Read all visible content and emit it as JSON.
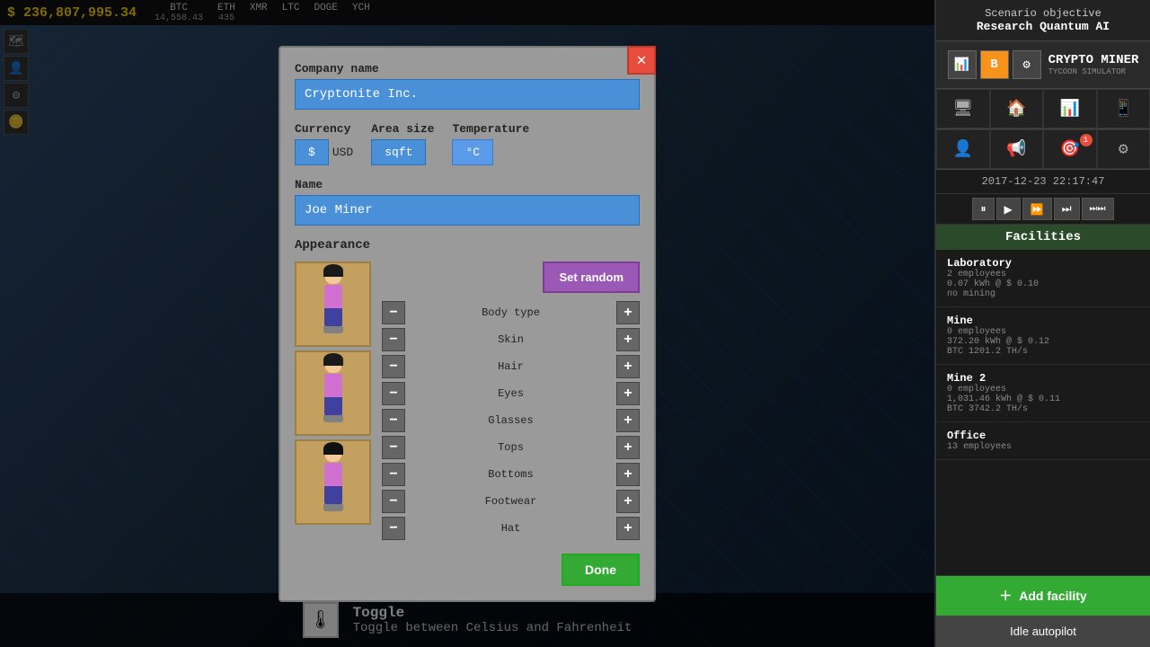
{
  "topbar": {
    "money": "$ 236,807,995.34",
    "cryptos": [
      {
        "symbol": "BTC",
        "value": "14,558.43"
      },
      {
        "symbol": "ETH",
        "value": "435"
      },
      {
        "symbol": "XMR",
        "value": ""
      },
      {
        "symbol": "LTC",
        "value": ""
      },
      {
        "symbol": "DOGE",
        "value": ""
      },
      {
        "symbol": "YCH",
        "value": ""
      }
    ]
  },
  "sidebar": {
    "scenario_label": "Scenario objective",
    "scenario_name": "Research Quantum AI",
    "logo_title": "CRYPTO MINER",
    "logo_sub": "TYCOON SIMULATOR",
    "datetime": "2017-12-23 22:17:47",
    "facilities_header": "Facilities",
    "facilities": [
      {
        "name": "Laboratory",
        "employees": "2 employees",
        "detail1": "0.07 kWh @ $ 0.10",
        "detail2": "no mining"
      },
      {
        "name": "Mine",
        "employees": "0 employees",
        "detail1": "372.20 kWh @ $ 0.12",
        "detail2": "BTC 1201.2 TH/s"
      },
      {
        "name": "Mine 2",
        "employees": "0 employees",
        "detail1": "1,031.46 kWh @ $ 0.11",
        "detail2": "BTC 3742.2 TH/s"
      },
      {
        "name": "Office",
        "employees": "13 employees",
        "detail1": "",
        "detail2": ""
      }
    ],
    "add_facility_btn": "Add facility",
    "idle_btn": "Idle autopilot",
    "notification_count": "1"
  },
  "modal": {
    "company_name_label": "Company name",
    "company_name_value": "Cryptonite Inc.",
    "currency_label": "Currency",
    "currency_symbol": "$",
    "currency_name": "USD",
    "area_label": "Area size",
    "area_value": "sqft",
    "temp_label": "Temperature",
    "temp_value": "°C",
    "name_label": "Name",
    "name_value": "Joe Miner",
    "appearance_label": "Appearance",
    "set_random_btn": "Set random",
    "done_btn": "Done",
    "appearance_rows": [
      {
        "label": "Body type"
      },
      {
        "label": "Skin"
      },
      {
        "label": "Hair"
      },
      {
        "label": "Eyes"
      },
      {
        "label": "Glasses"
      },
      {
        "label": "Tops"
      },
      {
        "label": "Bottoms"
      },
      {
        "label": "Footwear"
      },
      {
        "label": "Hat"
      }
    ]
  },
  "bottom": {
    "toggle_label": "Toggle",
    "toggle_desc": "Toggle between Celsius and Fahrenheit"
  },
  "icons": {
    "monitor": "🖥",
    "home": "🏠",
    "chart": "📊",
    "phone": "📱",
    "person": "👤",
    "megaphone": "📢",
    "target": "🎯",
    "gear": "⚙",
    "pause": "⏸",
    "play": "▶",
    "fast": "⏩",
    "faster": "⏭",
    "fastest": "⏭",
    "plus": "+",
    "minus": "−",
    "close": "✕"
  }
}
